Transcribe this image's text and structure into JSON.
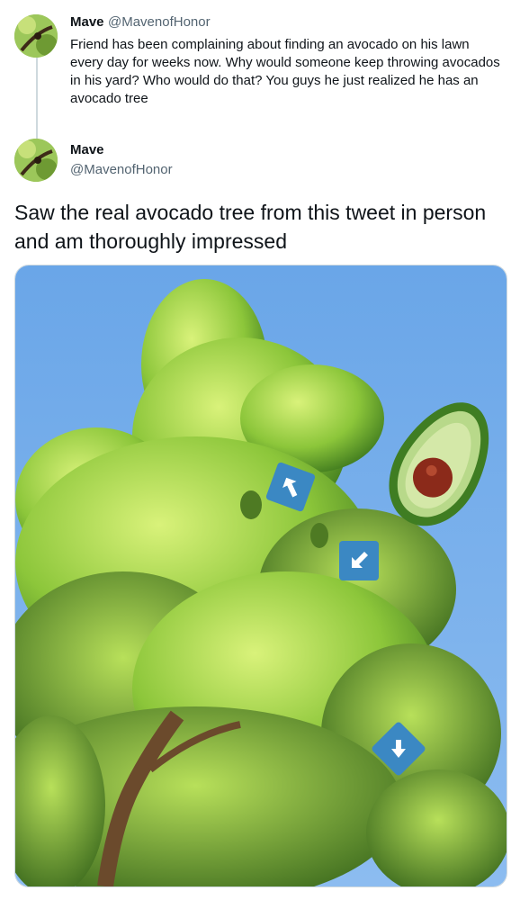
{
  "quoted_tweet": {
    "display_name": "Mave",
    "handle": "@MavenofHonor",
    "text": "Friend has been complaining about finding an avocado on his lawn every day for weeks now. Why would someone keep throwing avocados in his yard? Who would do that? You guys he just realized he has an avocado tree"
  },
  "main_tweet": {
    "display_name": "Mave",
    "handle": "@MavenofHonor",
    "text": "Saw the real avocado tree from this tweet in person and am thoroughly impressed"
  },
  "media": {
    "sky_color": "#6ea8e6",
    "icons": [
      "arrow-up-left-icon",
      "arrow-down-left-icon",
      "arrow-down-icon",
      "avocado-icon"
    ]
  }
}
